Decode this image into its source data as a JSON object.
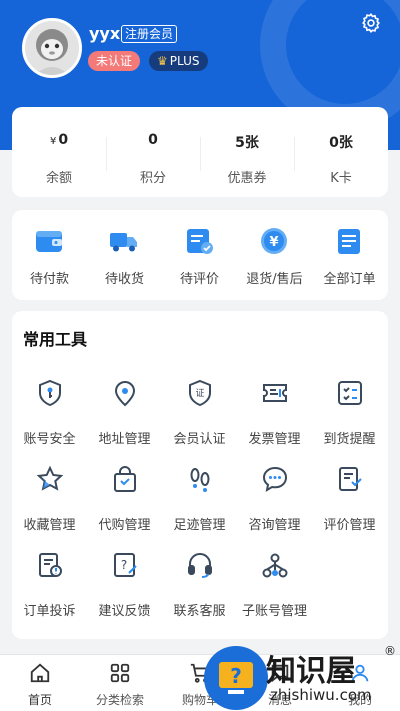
{
  "profile": {
    "username": "yyx",
    "member_tag": "注册会员",
    "unverified": "未认证",
    "plus": "PLUS"
  },
  "stats": [
    {
      "value": "0",
      "prefix": "¥",
      "label": "余额"
    },
    {
      "value": "0",
      "prefix": "",
      "label": "积分"
    },
    {
      "value": "5张",
      "prefix": "",
      "label": "优惠券"
    },
    {
      "value": "0张",
      "prefix": "",
      "label": "K卡"
    }
  ],
  "orders": [
    {
      "label": "待付款",
      "icon": "wallet-icon"
    },
    {
      "label": "待收货",
      "icon": "truck-icon"
    },
    {
      "label": "待评价",
      "icon": "review-icon"
    },
    {
      "label": "退货/售后",
      "icon": "refund-icon"
    },
    {
      "label": "全部订单",
      "icon": "orders-icon"
    }
  ],
  "tools": {
    "title": "常用工具",
    "items": [
      {
        "label": "账号安全",
        "icon": "key-shield-icon"
      },
      {
        "label": "地址管理",
        "icon": "location-pin-icon"
      },
      {
        "label": "会员认证",
        "icon": "certificate-icon"
      },
      {
        "label": "发票管理",
        "icon": "invoice-icon"
      },
      {
        "label": "到货提醒",
        "icon": "checklist-icon"
      },
      {
        "label": "收藏管理",
        "icon": "star-icon"
      },
      {
        "label": "代购管理",
        "icon": "shopping-bag-icon"
      },
      {
        "label": "足迹管理",
        "icon": "footprints-icon"
      },
      {
        "label": "咨询管理",
        "icon": "chat-bubble-icon"
      },
      {
        "label": "评价管理",
        "icon": "review-doc-icon"
      },
      {
        "label": "订单投诉",
        "icon": "complaint-doc-icon"
      },
      {
        "label": "建议反馈",
        "icon": "feedback-doc-icon"
      },
      {
        "label": "联系客服",
        "icon": "headset-icon"
      },
      {
        "label": "子账号管理",
        "icon": "org-chart-icon"
      }
    ]
  },
  "tabbar": [
    {
      "label": "首页",
      "icon": "home-icon"
    },
    {
      "label": "分类检索",
      "icon": "grid-icon"
    },
    {
      "label": "购物车",
      "icon": "cart-icon"
    },
    {
      "label": "消息",
      "icon": "message-icon"
    },
    {
      "label": "我的",
      "icon": "user-icon"
    }
  ],
  "watermark": {
    "title": "知识屋",
    "subtitle": "zhishiwu.com",
    "reg": "®"
  },
  "colors": {
    "brand_blue": "#1565d8",
    "accent_blue": "#2e8bf0",
    "badge_red": "#f47a7a",
    "plus_navy": "#173c7d",
    "icon_gray": "#3a4a5c"
  }
}
